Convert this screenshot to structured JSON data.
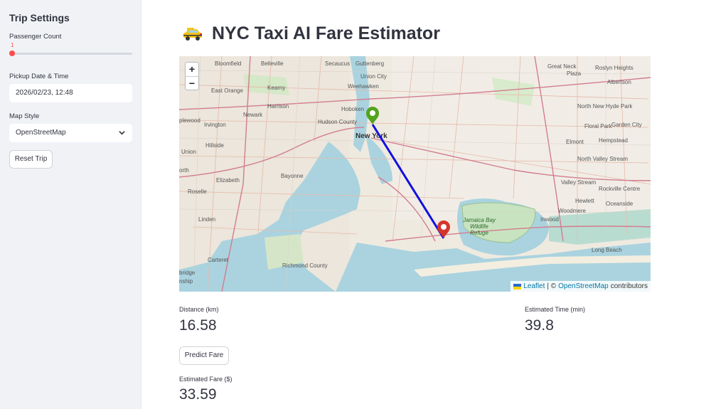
{
  "sidebar": {
    "title": "Trip Settings",
    "passenger_label": "Passenger Count",
    "passenger_value": "1",
    "passenger_fraction": 0.0,
    "datetime_label": "Pickup Date & Time",
    "datetime_value": "2026/02/23, 12:48",
    "map_style_label": "Map Style",
    "map_style_value": "OpenStreetMap",
    "reset_label": "Reset Trip"
  },
  "main": {
    "title": "NYC Taxi AI Fare Estimator",
    "title_icon": "taxi-icon",
    "map": {
      "zoom_in": "+",
      "zoom_out": "−",
      "attribution_leaflet": "Leaflet",
      "attribution_sep": "| ©",
      "attribution_osm": "OpenStreetMap",
      "attribution_tail": "contributors",
      "place_labels": [
        "Bloomfield",
        "Belleville",
        "Secaucus",
        "Union City",
        "Guttenberg",
        "Great Neck",
        "Roslyn Heights",
        "Plaza",
        "Albertson",
        "East Orange",
        "Kearny",
        "Weehawken",
        "Newark",
        "Harrison",
        "Hoboken",
        "New York",
        "North New Hyde Park",
        "Floral Park",
        "Garden City",
        "Irvington",
        "Hudson County",
        "Elmont",
        "Hempstead",
        "Hillside",
        "Union",
        "North Valley Stream",
        "Bayonne",
        "Elizabeth",
        "Valley Stream",
        "Rockville Centre",
        "Roselle",
        "Hewlett",
        "Oceanside",
        "Woodmere",
        "Inwood",
        "Linden",
        "Jamaica Bay Wildlife Refuge",
        "Long Beach",
        "Carteret",
        "Richmond County",
        "bridge",
        "nship",
        "plewood",
        "orth"
      ],
      "colors": {
        "water": "#aad3df",
        "route": "#1010e0",
        "pickup": "#52a31d",
        "dropoff": "#d6352b"
      }
    },
    "distance_label": "Distance (km)",
    "distance_value": "16.58",
    "time_label": "Estimated Time (min)",
    "time_value": "39.8",
    "predict_label": "Predict Fare",
    "fare_label": "Estimated Fare ($)",
    "fare_value": "33.59"
  }
}
